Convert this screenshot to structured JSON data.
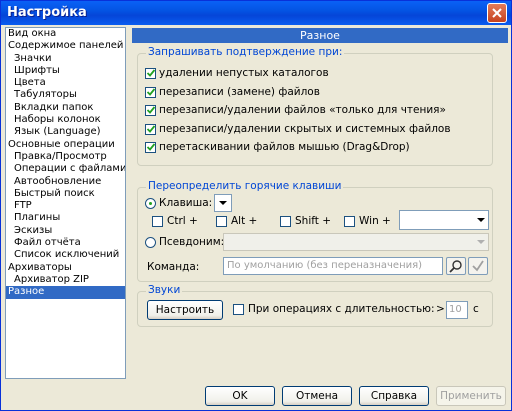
{
  "window": {
    "title": "Настройка"
  },
  "sidebar": {
    "items": [
      {
        "label": "Вид окна",
        "level": 0,
        "selected": false
      },
      {
        "label": "Содержимое панелей",
        "level": 0,
        "selected": false
      },
      {
        "label": "Значки",
        "level": 1,
        "selected": false
      },
      {
        "label": "Шрифты",
        "level": 1,
        "selected": false
      },
      {
        "label": "Цвета",
        "level": 1,
        "selected": false
      },
      {
        "label": "Табуляторы",
        "level": 1,
        "selected": false
      },
      {
        "label": "Вкладки папок",
        "level": 1,
        "selected": false
      },
      {
        "label": "Наборы колонок",
        "level": 1,
        "selected": false
      },
      {
        "label": "Язык (Language)",
        "level": 1,
        "selected": false
      },
      {
        "label": "Основные операции",
        "level": 0,
        "selected": false
      },
      {
        "label": "Правка/Просмотр",
        "level": 1,
        "selected": false
      },
      {
        "label": "Операции с файлами",
        "level": 1,
        "selected": false
      },
      {
        "label": "Автообновление",
        "level": 1,
        "selected": false
      },
      {
        "label": "Быстрый поиск",
        "level": 1,
        "selected": false
      },
      {
        "label": "FTP",
        "level": 1,
        "selected": false
      },
      {
        "label": "Плагины",
        "level": 1,
        "selected": false
      },
      {
        "label": "Эскизы",
        "level": 1,
        "selected": false
      },
      {
        "label": "Файл отчёта",
        "level": 1,
        "selected": false
      },
      {
        "label": "Список исключений",
        "level": 1,
        "selected": false
      },
      {
        "label": "Архиваторы",
        "level": 0,
        "selected": false
      },
      {
        "label": "Архиватор ZIP",
        "level": 1,
        "selected": false
      },
      {
        "label": "Разное",
        "level": 0,
        "selected": true
      }
    ]
  },
  "panel": {
    "title": "Разное"
  },
  "confirm": {
    "legend": "Запрашивать подтверждение при:",
    "options": [
      {
        "label": "удалении непустых каталогов",
        "checked": true
      },
      {
        "label": "перезаписи (замене) файлов",
        "checked": true
      },
      {
        "label": "перезаписи/удалении файлов «только для чтения»",
        "checked": true
      },
      {
        "label": "перезаписи/удалении скрытых и системных файлов",
        "checked": true
      },
      {
        "label": "перетаскивании файлов мышью (Drag&Drop)",
        "checked": true
      }
    ]
  },
  "hotkeys": {
    "legend": "Переопределить горячие клавиши",
    "key_label": "Клавиша:",
    "ctrl": "Ctrl +",
    "alt": "Alt +",
    "shift": "Shift +",
    "win": "Win +",
    "alias_label": "Псевдоним:",
    "command_label": "Команда:",
    "command_placeholder": "По умолчанию (без переназначения)"
  },
  "sounds": {
    "legend": "Звуки",
    "configure": "Настроить",
    "long_ops": "При операциях с длительностью:",
    "gt": ">",
    "seconds_value": "10",
    "seconds_unit": "с"
  },
  "buttons": {
    "ok": "OK",
    "cancel": "Отмена",
    "help": "Справка",
    "apply": "Применить"
  },
  "colors": {
    "accent": "#316AC5",
    "legend": "#0046D5",
    "face": "#ECE9D8"
  }
}
